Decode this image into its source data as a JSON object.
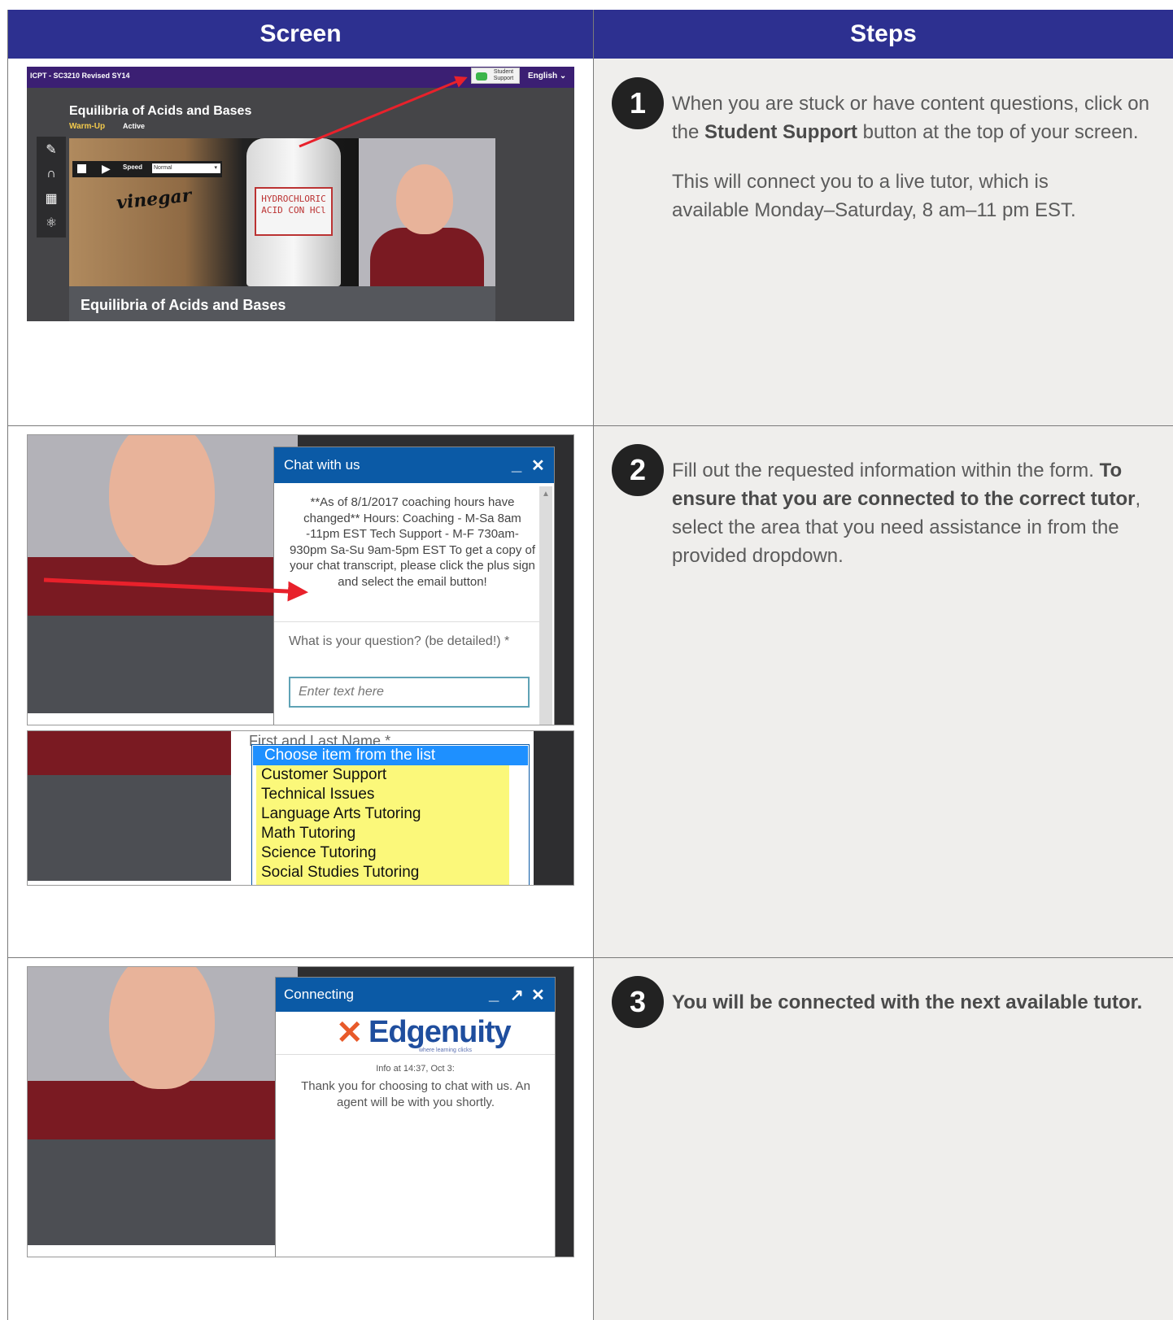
{
  "table": {
    "col_screen_header": "Screen",
    "col_steps_header": "Steps"
  },
  "steps": [
    {
      "number": "1",
      "paragraph_1_pre": "When you are stuck or have content questions, click on the ",
      "paragraph_1_bold": "Student Support",
      "paragraph_1_post": " button at the top of your screen.",
      "paragraph_2": "This will connect you to a live tutor, which is available Monday–Saturday, 8 am–11 pm EST."
    },
    {
      "number": "2",
      "paragraph_1_pre": "Fill out the requested information within the form. ",
      "paragraph_1_bold": "To ensure that you are connected to the correct tutor",
      "paragraph_1_post": ", select the area that you need assistance in from the provided dropdown."
    },
    {
      "number": "3",
      "paragraph_1_bold": "You will be connected with the next available tutor."
    }
  ],
  "screenshot_1": {
    "course_code": "ICPT - SC3210 Revised SY14",
    "support_button": "Student Support",
    "language": "English",
    "lesson_title": "Equilibria of Acids and Bases",
    "phase": "Warm-Up",
    "status": "Active",
    "speed_label": "Speed",
    "speed_value": "Normal",
    "video_label": "vinegar",
    "bottle_label": "HYDROCHLORIC ACID CON HCl",
    "caption": "Equilibria of Acids and Bases"
  },
  "screenshot_2": {
    "chat_title": "Chat with us",
    "minimize": "_",
    "close": "✕",
    "notice": "**As of 8/1/2017 coaching hours have changed** Hours: Coaching - M-Sa 8am -11pm EST Tech Support - M-F 730am- 930pm Sa-Su 9am-5pm EST To get a copy of your chat transcript, please click the plus sign and select the email button!",
    "question_label": "What is your question? (be detailed!) *",
    "question_placeholder": "Enter text here",
    "name_label": "First and Last Name *",
    "dropdown_selected": "Choose item from the list",
    "dropdown_options": [
      "Customer Support",
      "Technical Issues",
      "Language Arts Tutoring",
      "Math Tutoring",
      "Science Tutoring",
      "Social Studies Tutoring"
    ]
  },
  "screenshot_3": {
    "title": "Connecting",
    "minimize": "_",
    "popout": "↗",
    "close": "✕",
    "logo_text": "Edgenuity",
    "logo_tagline": "where learning clicks",
    "info": "Info at 14:37, Oct 3:",
    "message": "Thank you for choosing to chat with us. An agent will be with you shortly."
  },
  "colors": {
    "header_bg": "#2d3090",
    "steps_bg": "#efeeec",
    "chat_blue": "#0b5aa6",
    "arrow_red": "#e8212b",
    "dropdown_highlight": "#fbf87a"
  }
}
